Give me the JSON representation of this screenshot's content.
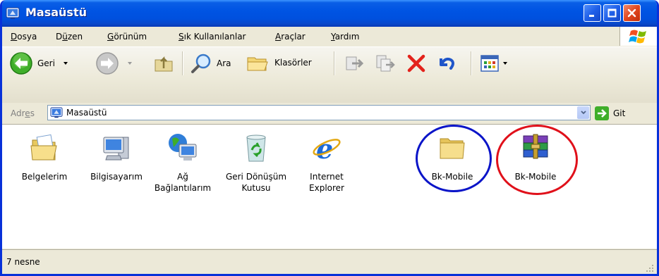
{
  "window": {
    "title": "Masaüstü"
  },
  "menu": {
    "items": [
      {
        "pre": "",
        "u": "D",
        "post": "osya"
      },
      {
        "pre": "D",
        "u": "ü",
        "post": "zen"
      },
      {
        "pre": "",
        "u": "G",
        "post": "örünüm"
      },
      {
        "pre": "",
        "u": "S",
        "post": "ık Kullanılanlar"
      },
      {
        "pre": "",
        "u": "A",
        "post": "raçlar"
      },
      {
        "pre": "",
        "u": "Y",
        "post": "ardım"
      }
    ]
  },
  "toolbar": {
    "back_label": "Geri",
    "search_label": "Ara",
    "folders_label": "Klasörler"
  },
  "address": {
    "label_pre": "Adr",
    "label_u": "e",
    "label_post": "s",
    "value": "Masaüstü",
    "go_label": "Git"
  },
  "desktop": {
    "items": [
      {
        "label": "Belgelerim",
        "icon": "my-documents-icon"
      },
      {
        "label": "Bilgisayarım",
        "icon": "my-computer-icon"
      },
      {
        "label": "Ağ Bağlantılarım",
        "icon": "network-connections-icon"
      },
      {
        "label": "Geri Dönüşüm Kutusu",
        "icon": "recycle-bin-icon"
      },
      {
        "label": "Internet Explorer",
        "icon": "internet-explorer-icon"
      },
      {
        "label": "Bk-Mobile",
        "icon": "folder-icon"
      },
      {
        "label": "Bk-Mobile",
        "icon": "winrar-archive-icon"
      }
    ],
    "highlight_colors": {
      "folder": "#0a14c8",
      "archive": "#e0101a"
    }
  },
  "status": {
    "text": "7 nesne"
  },
  "colors": {
    "titlebar": "#0054e3",
    "chrome": "#ece9d8",
    "window_border": "#0831d9"
  }
}
